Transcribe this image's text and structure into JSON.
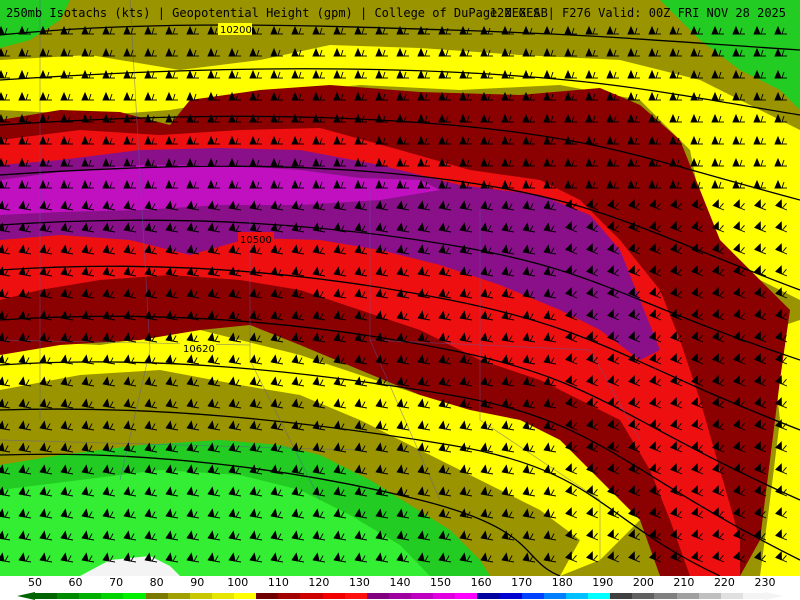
{
  "header": {
    "left": "250mb Isotachs (kts) | Geopotential Height (gpm) | College of DuPage NEXLAB",
    "right": "12Z GFS | F276 Valid: 00Z FRI NOV 28 2025"
  },
  "contour_labels": [
    "10200",
    "10500",
    "10620"
  ],
  "colorbar": {
    "ticks": [
      "50",
      "60",
      "70",
      "80",
      "90",
      "100",
      "110",
      "120",
      "130",
      "140",
      "150",
      "160",
      "170",
      "180",
      "190",
      "200",
      "210",
      "220",
      "230"
    ],
    "colors": [
      "#006400",
      "#008a00",
      "#00b000",
      "#00d400",
      "#00f000",
      "#7a7a00",
      "#a0a000",
      "#c8c800",
      "#e6e600",
      "#ffff00",
      "#700000",
      "#a00000",
      "#cc0000",
      "#f00000",
      "#ff1010",
      "#800080",
      "#a000a0",
      "#c000c0",
      "#e000e0",
      "#ff00ff",
      "#0000a0",
      "#0000d0",
      "#0040ff",
      "#0080ff",
      "#00c0ff",
      "#00ffff",
      "#404040",
      "#606060",
      "#808080",
      "#a0a0a0",
      "#c0c0c0",
      "#e0e0e0",
      "#f4f4f4"
    ]
  },
  "map_colors": {
    "green": "#22cc22",
    "olive": "#9a9400",
    "yellow": "#ffff00",
    "darkred": "#8b0000",
    "red": "#ee1010",
    "purple": "#8a108a",
    "magenta": "#c010c0"
  }
}
